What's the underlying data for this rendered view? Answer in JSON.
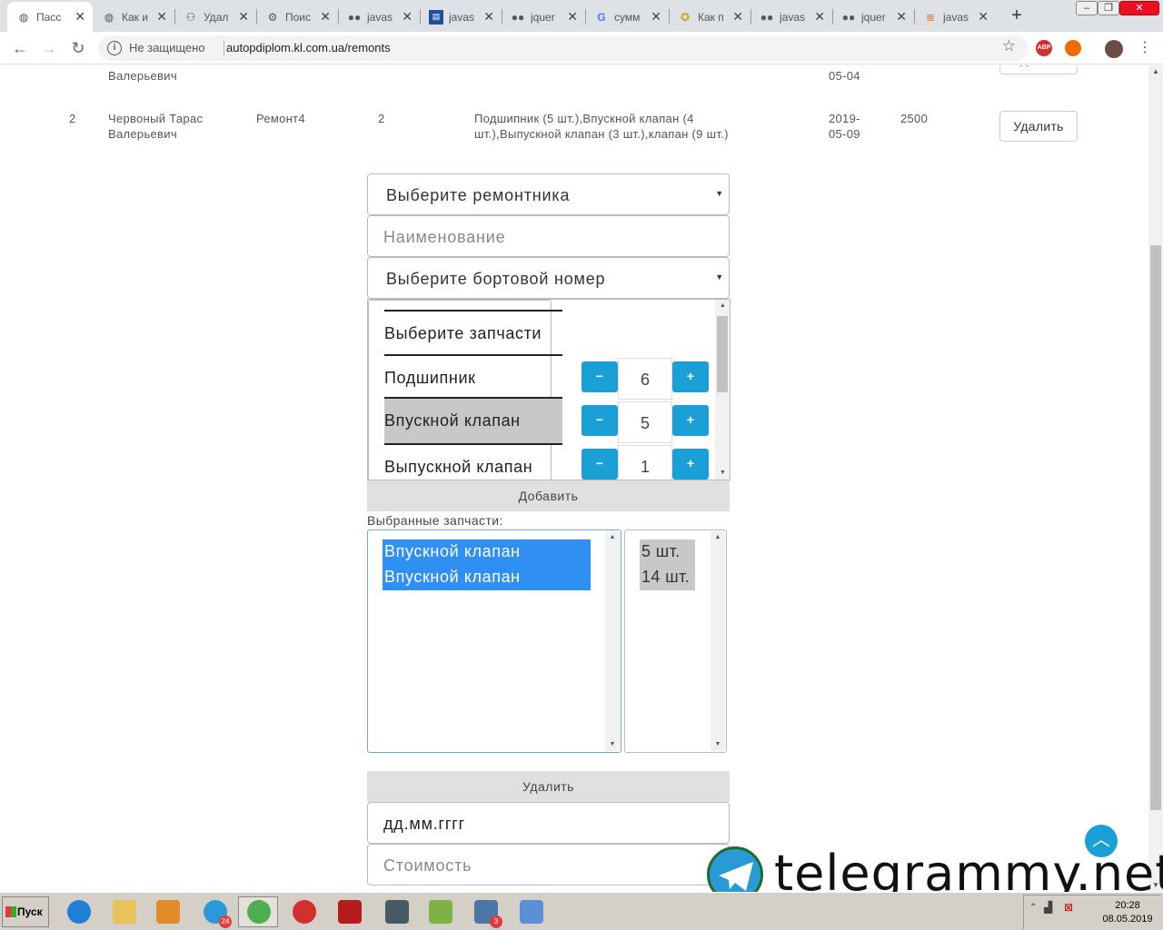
{
  "browser": {
    "tabs": [
      {
        "title": "Пасс",
        "icon": "globe-icon",
        "active": true
      },
      {
        "title": "Как и",
        "icon": "globe-icon"
      },
      {
        "title": "Удал",
        "icon": "share-icon"
      },
      {
        "title": "Поис",
        "icon": "gear-icon"
      },
      {
        "title": "javas",
        "icon": "glasses-icon"
      },
      {
        "title": "javas",
        "icon": "document-icon"
      },
      {
        "title": "jquer",
        "icon": "glasses-icon"
      },
      {
        "title": "сумм",
        "icon": "google-icon"
      },
      {
        "title": "Как п",
        "icon": "compass-icon"
      },
      {
        "title": "javas",
        "icon": "glasses-icon"
      },
      {
        "title": "jquer",
        "icon": "glasses-icon"
      },
      {
        "title": "javas",
        "icon": "stack-icon"
      }
    ],
    "new_tab": "+",
    "security_label": "Не защищено",
    "url": "autopdiplom.kl.com.ua/remonts",
    "extensions": [
      {
        "name": "abp-icon",
        "label": "ABP",
        "color": "#d32f2f"
      },
      {
        "name": "fire-icon",
        "label": "",
        "color": "#ef6c00"
      },
      {
        "name": "avatar",
        "label": "",
        "color": "#6d4c41"
      }
    ]
  },
  "table": {
    "rows": [
      {
        "num": "",
        "name": "Валерьевич",
        "repair": "",
        "board": "",
        "parts": "",
        "date_year": "",
        "date_md": "05-04",
        "cost": "",
        "action": "Удалить"
      },
      {
        "num": "2",
        "name": "Червоный Тарас Валерьевич",
        "repair": "Ремонт4",
        "board": "2",
        "parts": "Подшипник (5 шт.),Впускной клапан (4 шт.),Выпускной клапан (3 шт.),клапан (9 шт.)",
        "date_year": "2019-",
        "date_md": "05-09",
        "cost": "2500",
        "action": "Удалить"
      }
    ]
  },
  "form": {
    "repairman_select": "Выберите ремонтника",
    "name_placeholder": "Наименование",
    "board_select": "Выберите бортовой номер",
    "parts_header": "Выберите запчасти",
    "parts": [
      {
        "label": "Подшипник",
        "qty": "6",
        "selected": false
      },
      {
        "label": "Впускной клапан",
        "qty": "5",
        "selected": true
      },
      {
        "label": "Выпускной клапан",
        "qty": "1",
        "selected": false
      }
    ],
    "minus": "−",
    "plus": "+",
    "add_button": "Добавить",
    "selected_label": "Выбранные запчасти:",
    "selected_parts": [
      "Впускной клапан",
      "Впускной клапан"
    ],
    "selected_qty": [
      "5 шт.",
      "14 шт."
    ],
    "delete_button": "Удалить",
    "date_value": "дд.мм.гггг",
    "cost_placeholder": "Стоимость"
  },
  "scroll_top_icon": "arrow-up-icon",
  "watermark": "telegrammy.net",
  "taskbar": {
    "start_label": "Пуск",
    "apps": [
      {
        "name": "ie-icon",
        "color": "#1e7fd6",
        "badge": ""
      },
      {
        "name": "folder-icon",
        "color": "#e8c25a",
        "badge": ""
      },
      {
        "name": "media-icon",
        "color": "#e08a2a",
        "badge": ""
      },
      {
        "name": "telegram-icon",
        "color": "#2a9ad6",
        "badge": "24"
      },
      {
        "name": "chrome-icon",
        "color": "#4caf50",
        "badge": ""
      },
      {
        "name": "opera-icon",
        "color": "#d32f2f",
        "badge": ""
      },
      {
        "name": "filezilla-icon",
        "color": "#b71c1c",
        "badge": ""
      },
      {
        "name": "terminal-icon",
        "color": "#455a64",
        "badge": ""
      },
      {
        "name": "notepad-icon",
        "color": "#7cb342",
        "badge": ""
      },
      {
        "name": "vk-icon",
        "color": "#4a76a8",
        "badge": "3"
      },
      {
        "name": "control-panel-icon",
        "color": "#5b8fd6",
        "badge": ""
      }
    ],
    "time": "20:28",
    "date": "08.05.2019"
  }
}
